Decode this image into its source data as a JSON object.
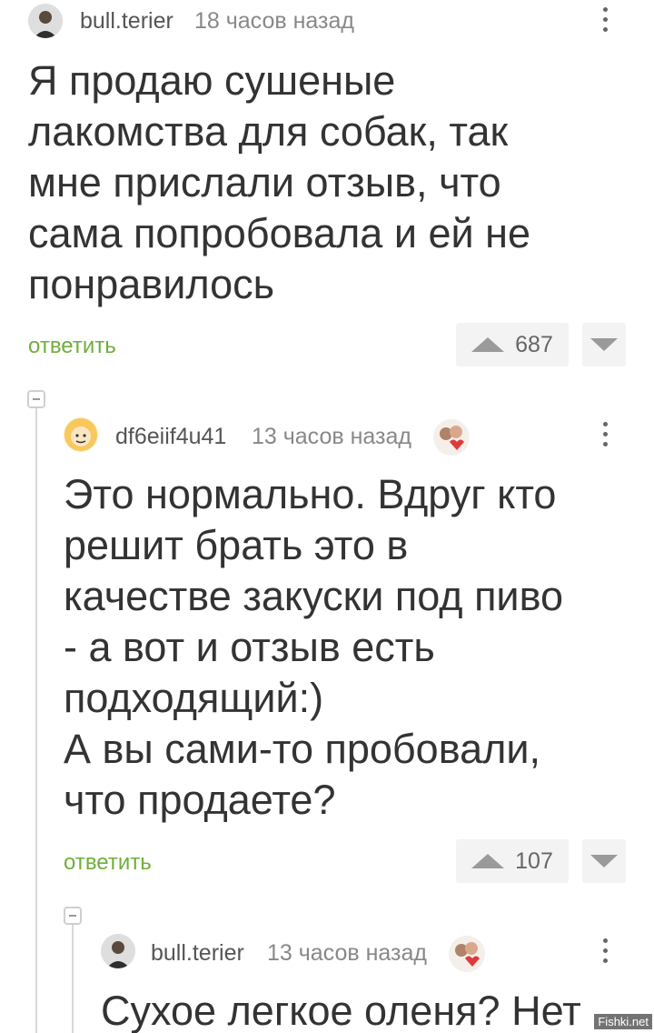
{
  "comments": [
    {
      "username": "bull.terier",
      "time": "18 часов назад",
      "text": "Я продаю сушеные\nлакомства для собак, так\nмне прислали отзыв, что\nсама попробовала и ей не\nпонравилось",
      "reply_label": "ответить",
      "votes": "687"
    },
    {
      "username": "df6eiif4u41",
      "time": "13 часов назад",
      "text": "Это нормально. Вдруг кто\nрешит брать это в\nкачестве закуски под пиво\n- а вот и отзыв есть\nподходящий:)\nА вы сами-то пробовали,\nчто продаете?",
      "reply_label": "ответить",
      "votes": "107"
    },
    {
      "username": "bull.terier",
      "time": "13 часов назад",
      "text": "Сухое легкое оленя? Нет"
    }
  ],
  "watermark": "Fishki.net",
  "colors": {
    "reply": "#6fae3b",
    "background": "#ffffff",
    "vote_box": "#f3f3f3"
  }
}
